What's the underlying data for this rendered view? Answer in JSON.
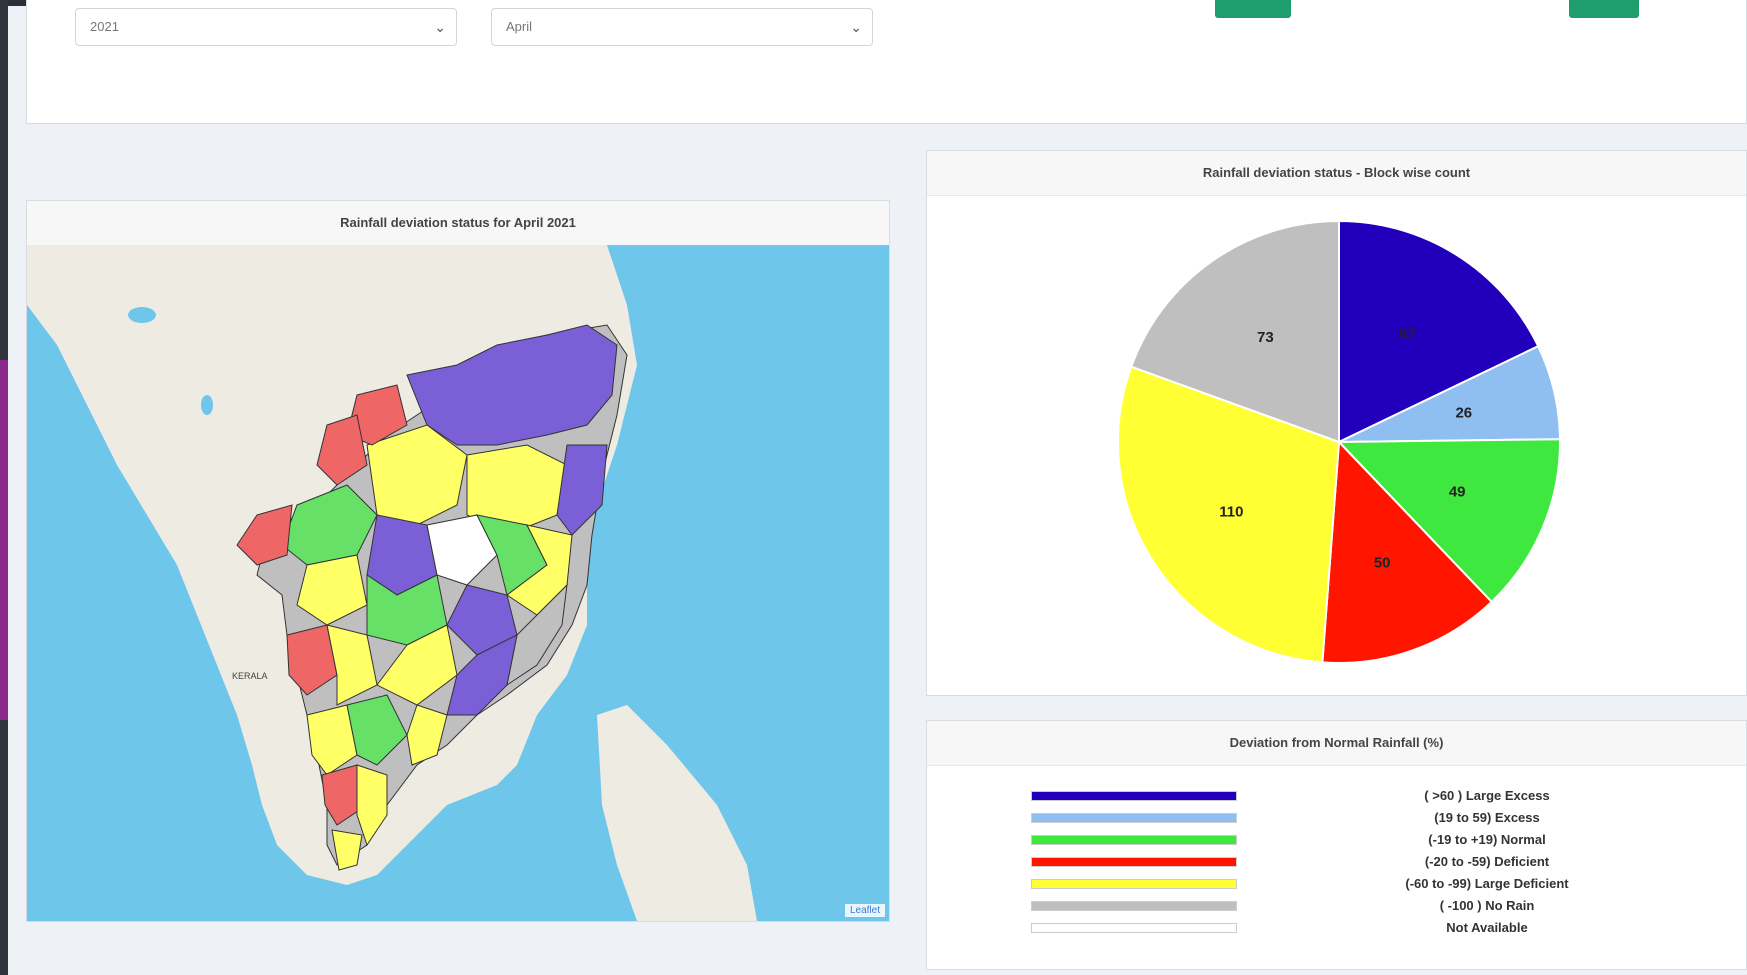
{
  "filters": {
    "year": "2021",
    "month": "April"
  },
  "icons": {
    "year_chevron": "chevron-down-icon",
    "month_chevron": "chevron-down-icon"
  },
  "map_panel": {
    "title": "Rainfall deviation status for April 2021",
    "region_label": "KERALA",
    "attribution": "Leaflet"
  },
  "pie_panel": {
    "title": "Rainfall deviation status - Block wise count"
  },
  "chart_data": {
    "type": "pie",
    "categories": [
      "Large Excess",
      "Excess",
      "Normal",
      "Deficient",
      "Large Deficient",
      "No Rain"
    ],
    "values": [
      67,
      26,
      49,
      50,
      110,
      73
    ],
    "colors": [
      "#2200bb",
      "#8fbff0",
      "#3ee83e",
      "#ff1500",
      "#ffff33",
      "#bfbfbf"
    ],
    "data_labels": [
      "67",
      "26",
      "49",
      "50",
      "110",
      "73"
    ]
  },
  "legend_panel": {
    "title": "Deviation from Normal Rainfall (%)",
    "items": [
      {
        "label": "( >60 ) Large Excess",
        "color": "#2200bb"
      },
      {
        "label": "(19 to 59) Excess",
        "color": "#8fbff0"
      },
      {
        "label": "(-19 to +19) Normal",
        "color": "#3ee83e"
      },
      {
        "label": "(-20 to -59) Deficient",
        "color": "#ff1500"
      },
      {
        "label": "(-60 to -99) Large Deficient",
        "color": "#ffff33"
      },
      {
        "label": "( -100 ) No Rain",
        "color": "#bfbfbf"
      },
      {
        "label": "Not Available",
        "color": "#ffffff"
      }
    ]
  }
}
